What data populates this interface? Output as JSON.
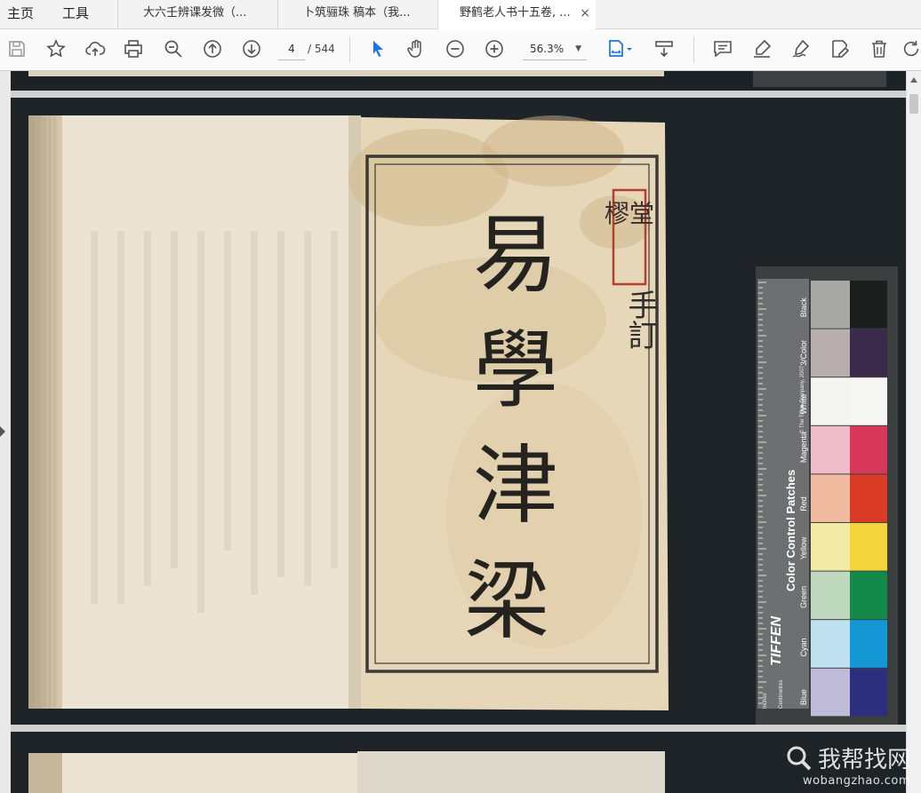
{
  "menu": {
    "home": "主页",
    "tools": "工具"
  },
  "tabs": [
    {
      "label": "大六壬辨课发微（..."
    },
    {
      "label": "卜筑骊珠 稿本（我..."
    },
    {
      "label": "野鹤老人书十五卷, ...",
      "close": "×"
    }
  ],
  "toolbar": {
    "page_current": "4",
    "page_total": "/ 544",
    "zoom": "56.3%",
    "icons": [
      "save-icon",
      "bookmark-star-icon",
      "upload-cloud-icon",
      "print-icon",
      "zoom-search-icon",
      "previous-page-icon",
      "next-page-icon",
      "select-cursor-icon",
      "hand-tool-icon",
      "zoom-out-icon",
      "zoom-in-icon",
      "fit-page-icon",
      "scroll-mode-icon",
      "comment-icon",
      "highlight-pen-icon",
      "sign-icon",
      "edit-pdf-icon",
      "delete-icon",
      "rotate-icon"
    ]
  },
  "document": {
    "book_title": [
      "易",
      "學",
      "津",
      "梁"
    ],
    "seal": "樛堂",
    "annotation": "手訂",
    "color_card": {
      "brand": "TIFFEN",
      "title": "Color Control Patches",
      "copyright": "© The Tiffen Company, 2007",
      "units": [
        "Inches",
        "Centimetres"
      ],
      "patches": [
        {
          "name": "Black",
          "light": "#a8a8a6",
          "dark": "#1b1e1c"
        },
        {
          "name": "3/Color",
          "light": "#b9aeae",
          "dark": "#3b2a4a"
        },
        {
          "name": "White",
          "light": "#f4f4f2",
          "dark": "#f6f6f4"
        },
        {
          "name": "Magenta",
          "light": "#eebcc8",
          "dark": "#d8385a"
        },
        {
          "name": "Red",
          "light": "#f2bba0",
          "dark": "#da3b27"
        },
        {
          "name": "Yellow",
          "light": "#f3eaa6",
          "dark": "#f3d43a"
        },
        {
          "name": "Green",
          "light": "#bdd8bd",
          "dark": "#138a4a"
        },
        {
          "name": "Cyan",
          "light": "#bfe1ef",
          "dark": "#1597d6"
        },
        {
          "name": "Blue",
          "light": "#bfbbd8",
          "dark": "#2b2f7e"
        }
      ]
    }
  },
  "watermark": {
    "text": "我帮找网",
    "url": "wobangzhao.com"
  },
  "colors": {
    "accent": "#1a73e8",
    "paper": "#ece3cf",
    "page_bg": "#1d2226"
  }
}
